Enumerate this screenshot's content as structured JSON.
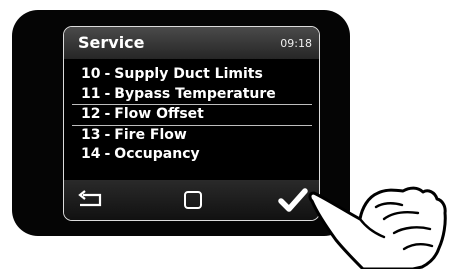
{
  "screen": {
    "title": "Service",
    "time": "09:18"
  },
  "menu": {
    "items": [
      {
        "number": "10",
        "label": "Supply Duct Limits"
      },
      {
        "number": "11",
        "label": "Bypass Temperature"
      },
      {
        "number": "12",
        "label": "Flow Offset"
      },
      {
        "number": "13",
        "label": "Fire Flow"
      },
      {
        "number": "14",
        "label": "Occupancy"
      }
    ],
    "separator": "-",
    "selected_index": 2
  },
  "buttons": {
    "back_icon": "back-arrow-icon",
    "home_icon": "square-icon",
    "ok_icon": "checkmark-icon"
  },
  "colors": {
    "screen_bg": "#000000",
    "text": "#ffffff",
    "bezel": "#050505"
  }
}
